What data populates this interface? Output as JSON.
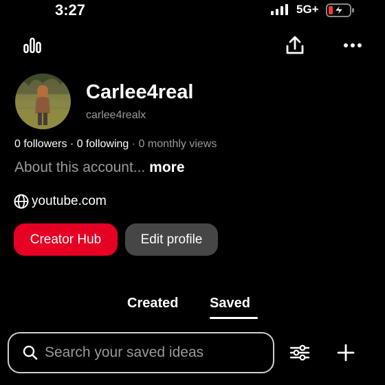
{
  "status_bar": {
    "time": "3:27",
    "network": "5G+",
    "battery_state": "low-charging",
    "battery_color": "#ff3b30"
  },
  "top_bar": {
    "left_icon": "bar-chart-icon",
    "share_icon": "share-icon",
    "more_icon": "more-horizontal-icon"
  },
  "profile": {
    "display_name": "Carlee4real",
    "username": "carlee4realx",
    "followers": "0 followers",
    "separator": " · ",
    "following": "0 following",
    "monthly_views": "0 monthly views",
    "about": "About this account...",
    "more_label": "more",
    "website": "youtube.com"
  },
  "buttons": {
    "creator_hub": "Creator Hub",
    "edit_profile": "Edit profile"
  },
  "tabs": [
    {
      "label": "Created",
      "selected": false
    },
    {
      "label": "Saved",
      "selected": true
    }
  ],
  "search": {
    "placeholder": "Search your saved ideas"
  },
  "colors": {
    "accent": "#e60023",
    "secondary_button": "#464646",
    "background": "#000000",
    "muted_text": "#9a9a9a"
  }
}
